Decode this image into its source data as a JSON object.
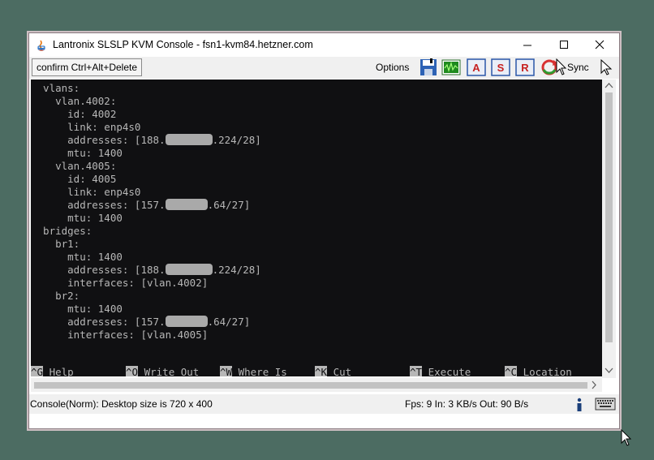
{
  "window": {
    "title": "Lantronix SLSLP KVM Console - fsn1-kvm84.hetzner.com"
  },
  "toolbar": {
    "cad_label": "confirm Ctrl+Alt+Delete",
    "options_label": "Options",
    "icons": [
      "save-icon",
      "video-icon",
      "a-icon",
      "s-icon",
      "r-icon",
      "sync-icon",
      "mouse-pointer-icon"
    ],
    "sync_label": "Sync"
  },
  "terminal": {
    "lines": [
      "  vlans:",
      "    vlan.4002:",
      "      id: 4002",
      "      link: enp4s0",
      "      addresses: [188.",
      "      mtu: 1400",
      "    vlan.4005:",
      "      id: 4005",
      "      link: enp4s0",
      "      addresses: [157.",
      "      mtu: 1400",
      "  bridges:",
      "    br1:",
      "      mtu: 1400",
      "      addresses: [188.",
      "      interfaces: [vlan.4002]",
      "    br2:",
      "      mtu: 1400",
      "      addresses: [157.",
      "      interfaces: [vlan.4005]"
    ],
    "addr_suffix_1": ".224/28]",
    "addr_suffix_2": ".64/27]",
    "shortcuts": [
      {
        "key": "^G",
        "label": " Help"
      },
      {
        "key": "^O",
        "label": " Write Out"
      },
      {
        "key": "^W",
        "label": " Where Is"
      },
      {
        "key": "^K",
        "label": " Cut"
      },
      {
        "key": "^T",
        "label": " Execute"
      },
      {
        "key": "^C",
        "label": " Location"
      }
    ]
  },
  "status": {
    "left": "Console(Norm): Desktop size is 720 x 400",
    "right": "Fps: 9 In: 3 KB/s Out: 90 B/s",
    "icons": [
      "info-icon",
      "keyboard-icon"
    ]
  },
  "colors": {
    "desktop": "#4c6c62",
    "terminal_bg": "#101012",
    "terminal_fg": "#b7b7b7",
    "redaction": "#a9a9a9"
  }
}
